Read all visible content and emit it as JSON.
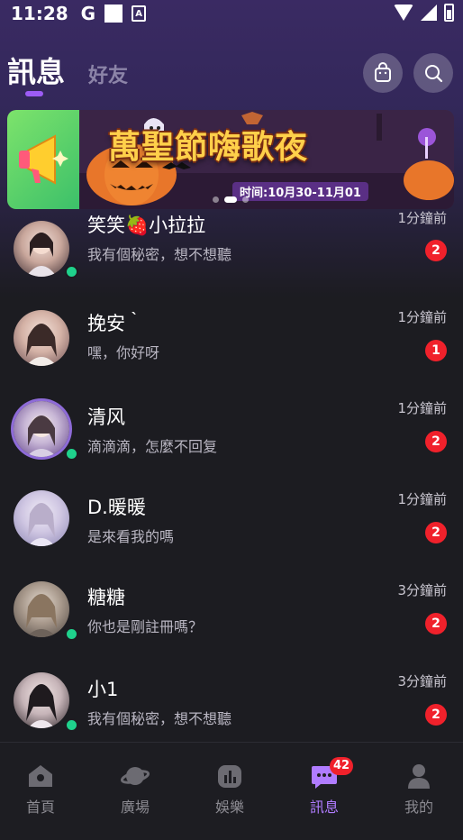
{
  "status_bar": {
    "time": "11:28",
    "g_label": "G"
  },
  "header": {
    "tabs": [
      {
        "label": "訊息",
        "active": true
      },
      {
        "label": "好友",
        "active": false
      }
    ],
    "icons": [
      "shopping-bag-icon",
      "search-icon"
    ]
  },
  "banner": {
    "title": "萬聖節嗨歌夜",
    "date": "时间:10月30-11月01",
    "dots": 3,
    "active_dot": 2
  },
  "conversations": [
    {
      "name": "笑笑🍓小拉拉",
      "message": "我有個秘密，想不想聽",
      "time": "1分鐘前",
      "unread": "2",
      "online": true
    },
    {
      "name": "挽安｀",
      "message": "嘿，你好呀",
      "time": "1分鐘前",
      "unread": "1",
      "online": false
    },
    {
      "name": "清风",
      "message": "滴滴滴，怎麼不回复",
      "time": "1分鐘前",
      "unread": "2",
      "online": true
    },
    {
      "name": "D.暖暖",
      "message": "是來看我的嗎",
      "time": "1分鐘前",
      "unread": "2",
      "online": false
    },
    {
      "name": "糖糖",
      "message": "你也是剛註冊嗎？",
      "time": "3分鐘前",
      "unread": "2",
      "online": true
    },
    {
      "name": "小1",
      "message": "我有個秘密，想不想聽",
      "time": "3分鐘前",
      "unread": "2",
      "online": true
    }
  ],
  "bottom_nav": {
    "items": [
      {
        "label": "首頁",
        "icon": "home-icon",
        "active": false
      },
      {
        "label": "廣場",
        "icon": "planet-icon",
        "active": false
      },
      {
        "label": "娛樂",
        "icon": "chart-icon",
        "active": false
      },
      {
        "label": "訊息",
        "icon": "chat-icon",
        "active": true,
        "badge": "42"
      },
      {
        "label": "我的",
        "icon": "profile-icon",
        "active": false
      }
    ]
  },
  "colors": {
    "accent": "#9d5cf5",
    "badge": "#f0212b",
    "online": "#1fd18c",
    "background": "#1c1c21"
  }
}
